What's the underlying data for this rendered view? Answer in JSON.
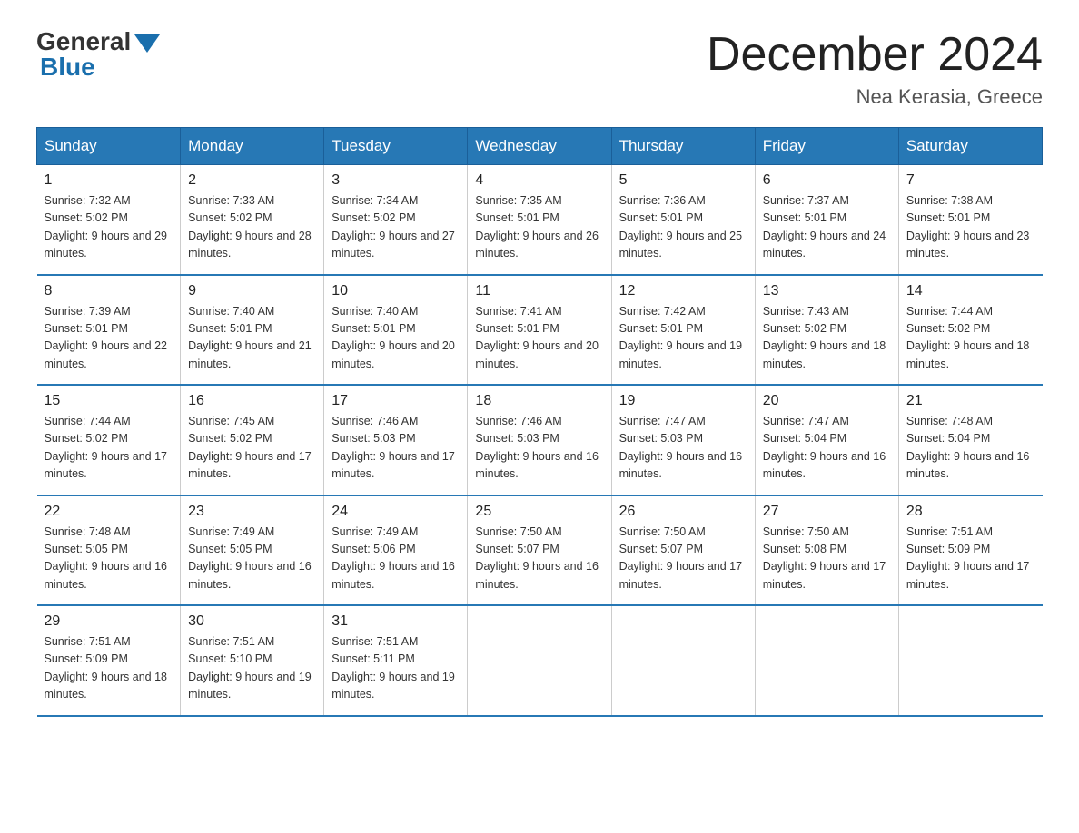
{
  "logo": {
    "general": "General",
    "blue": "Blue"
  },
  "title": "December 2024",
  "subtitle": "Nea Kerasia, Greece",
  "days_of_week": [
    "Sunday",
    "Monday",
    "Tuesday",
    "Wednesday",
    "Thursday",
    "Friday",
    "Saturday"
  ],
  "weeks": [
    [
      {
        "day": "1",
        "sunrise": "7:32 AM",
        "sunset": "5:02 PM",
        "daylight": "9 hours and 29 minutes."
      },
      {
        "day": "2",
        "sunrise": "7:33 AM",
        "sunset": "5:02 PM",
        "daylight": "9 hours and 28 minutes."
      },
      {
        "day": "3",
        "sunrise": "7:34 AM",
        "sunset": "5:02 PM",
        "daylight": "9 hours and 27 minutes."
      },
      {
        "day": "4",
        "sunrise": "7:35 AM",
        "sunset": "5:01 PM",
        "daylight": "9 hours and 26 minutes."
      },
      {
        "day": "5",
        "sunrise": "7:36 AM",
        "sunset": "5:01 PM",
        "daylight": "9 hours and 25 minutes."
      },
      {
        "day": "6",
        "sunrise": "7:37 AM",
        "sunset": "5:01 PM",
        "daylight": "9 hours and 24 minutes."
      },
      {
        "day": "7",
        "sunrise": "7:38 AM",
        "sunset": "5:01 PM",
        "daylight": "9 hours and 23 minutes."
      }
    ],
    [
      {
        "day": "8",
        "sunrise": "7:39 AM",
        "sunset": "5:01 PM",
        "daylight": "9 hours and 22 minutes."
      },
      {
        "day": "9",
        "sunrise": "7:40 AM",
        "sunset": "5:01 PM",
        "daylight": "9 hours and 21 minutes."
      },
      {
        "day": "10",
        "sunrise": "7:40 AM",
        "sunset": "5:01 PM",
        "daylight": "9 hours and 20 minutes."
      },
      {
        "day": "11",
        "sunrise": "7:41 AM",
        "sunset": "5:01 PM",
        "daylight": "9 hours and 20 minutes."
      },
      {
        "day": "12",
        "sunrise": "7:42 AM",
        "sunset": "5:01 PM",
        "daylight": "9 hours and 19 minutes."
      },
      {
        "day": "13",
        "sunrise": "7:43 AM",
        "sunset": "5:02 PM",
        "daylight": "9 hours and 18 minutes."
      },
      {
        "day": "14",
        "sunrise": "7:44 AM",
        "sunset": "5:02 PM",
        "daylight": "9 hours and 18 minutes."
      }
    ],
    [
      {
        "day": "15",
        "sunrise": "7:44 AM",
        "sunset": "5:02 PM",
        "daylight": "9 hours and 17 minutes."
      },
      {
        "day": "16",
        "sunrise": "7:45 AM",
        "sunset": "5:02 PM",
        "daylight": "9 hours and 17 minutes."
      },
      {
        "day": "17",
        "sunrise": "7:46 AM",
        "sunset": "5:03 PM",
        "daylight": "9 hours and 17 minutes."
      },
      {
        "day": "18",
        "sunrise": "7:46 AM",
        "sunset": "5:03 PM",
        "daylight": "9 hours and 16 minutes."
      },
      {
        "day": "19",
        "sunrise": "7:47 AM",
        "sunset": "5:03 PM",
        "daylight": "9 hours and 16 minutes."
      },
      {
        "day": "20",
        "sunrise": "7:47 AM",
        "sunset": "5:04 PM",
        "daylight": "9 hours and 16 minutes."
      },
      {
        "day": "21",
        "sunrise": "7:48 AM",
        "sunset": "5:04 PM",
        "daylight": "9 hours and 16 minutes."
      }
    ],
    [
      {
        "day": "22",
        "sunrise": "7:48 AM",
        "sunset": "5:05 PM",
        "daylight": "9 hours and 16 minutes."
      },
      {
        "day": "23",
        "sunrise": "7:49 AM",
        "sunset": "5:05 PM",
        "daylight": "9 hours and 16 minutes."
      },
      {
        "day": "24",
        "sunrise": "7:49 AM",
        "sunset": "5:06 PM",
        "daylight": "9 hours and 16 minutes."
      },
      {
        "day": "25",
        "sunrise": "7:50 AM",
        "sunset": "5:07 PM",
        "daylight": "9 hours and 16 minutes."
      },
      {
        "day": "26",
        "sunrise": "7:50 AM",
        "sunset": "5:07 PM",
        "daylight": "9 hours and 17 minutes."
      },
      {
        "day": "27",
        "sunrise": "7:50 AM",
        "sunset": "5:08 PM",
        "daylight": "9 hours and 17 minutes."
      },
      {
        "day": "28",
        "sunrise": "7:51 AM",
        "sunset": "5:09 PM",
        "daylight": "9 hours and 17 minutes."
      }
    ],
    [
      {
        "day": "29",
        "sunrise": "7:51 AM",
        "sunset": "5:09 PM",
        "daylight": "9 hours and 18 minutes."
      },
      {
        "day": "30",
        "sunrise": "7:51 AM",
        "sunset": "5:10 PM",
        "daylight": "9 hours and 19 minutes."
      },
      {
        "day": "31",
        "sunrise": "7:51 AM",
        "sunset": "5:11 PM",
        "daylight": "9 hours and 19 minutes."
      },
      null,
      null,
      null,
      null
    ]
  ]
}
